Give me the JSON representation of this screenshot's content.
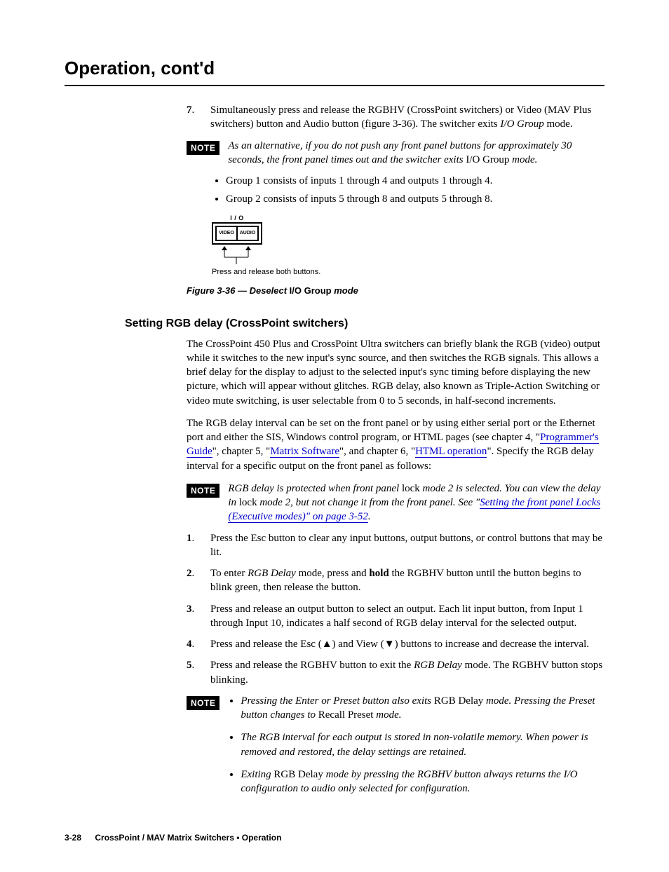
{
  "header": {
    "title": "Operation, cont'd"
  },
  "step7": {
    "num": "7",
    "text_a": "Simultaneously press and release the RGBHV (CrossPoint switchers) or Video (MAV Plus switchers) button and Audio button (figure 3-36).  The switcher exits ",
    "text_b": "I/O Group",
    "text_c": " mode."
  },
  "note1": {
    "label": "NOTE",
    "a": "As an alternative, if you do not push any front panel buttons for approximately 30 seconds, the front panel times out and the switcher exits ",
    "b": "I/O Group",
    "c": " mode."
  },
  "groups": {
    "g1": "Group 1 consists of inputs 1 through 4 and outputs 1 through 4.",
    "g2": "Group 2 consists of inputs 5 through 8 and outputs 5 through 8."
  },
  "io_diagram": {
    "header": "I / O",
    "btn_video": "VIDEO",
    "btn_audio": "AUDIO",
    "subcaption": "Press and release both buttons."
  },
  "fig_caption": {
    "a": "Figure 3-36 — Deselect ",
    "b": "I/O Group",
    "c": " mode"
  },
  "section": {
    "heading": "Setting RGB delay (CrossPoint switchers)"
  },
  "para1": "The CrossPoint 450 Plus and CrossPoint Ultra switchers can briefly blank the RGB (video) output while it switches to the new input's sync source, and then switches the RGB signals.  This allows a brief delay for the display to adjust to the selected input's sync timing before displaying the new picture, which will appear without glitches.  RGB delay, also known as Triple-Action Switching or video mute switching, is user selectable from 0 to 5 seconds, in half-second increments.",
  "para2": {
    "a": "The RGB delay interval can be set on the front panel or by using either serial port or the Ethernet port and either the SIS, Windows control program, or HTML pages (see chapter 4, \"",
    "link1": "Programmer's Guide",
    "b": "\", chapter 5, \"",
    "link2": "Matrix Software",
    "c": "\", and chapter 6, \"",
    "link3": "HTML operation",
    "d": "\".  Specify the RGB delay interval for a specific output on the front panel as follows:"
  },
  "note2": {
    "label": "NOTE",
    "a": "RGB delay is protected when front panel ",
    "b": "lock",
    "c": " mode 2 is selected.  You can view the delay in ",
    "d": "lock",
    "e": " mode 2, but not change it from the front panel.  See \"",
    "link": "Setting the front panel Locks (Executive modes)\" on page 3-52",
    "f": "."
  },
  "steps": {
    "s1": {
      "num": "1",
      "text": "Press the Esc button to clear any input buttons, output buttons, or control buttons that may be lit."
    },
    "s2": {
      "num": "2",
      "a": "To enter ",
      "b": "RGB Delay",
      "c": " mode, press and ",
      "d": "hold",
      "e": " the RGBHV button until the button begins to blink green, then release the button."
    },
    "s3": {
      "num": "3",
      "text": "Press and release an output button to select an output.  Each lit input button, from Input 1 through Input 10, indicates a half second of RGB delay interval for the selected output."
    },
    "s4": {
      "num": "4",
      "a": "Press and release the Esc (",
      "up": "▲",
      "b": ") and View (",
      "down": "▼",
      "c": ") buttons to increase and decrease the interval."
    },
    "s5": {
      "num": "5",
      "a": "Press and release the RGBHV button to exit the ",
      "b": "RGB Delay",
      "c": " mode.  The RGBHV button stops blinking."
    }
  },
  "note3": {
    "label": "NOTE",
    "b1a": "Pressing the Enter or Preset button also exits ",
    "b1b": "RGB Delay",
    "b1c": " mode.  Pressing the Preset button changes to ",
    "b1d": "Recall Preset",
    "b1e": " mode.",
    "b2": "The RGB interval for each output is stored in non-volatile memory.  When power is removed and restored, the delay settings are retained.",
    "b3a": "Exiting ",
    "b3b": "RGB Delay",
    "b3c": " mode by pressing the RGBHV button always returns the I/O configuration to audio only selected for configuration."
  },
  "footer": {
    "page": "3-28",
    "text": "CrossPoint / MAV Matrix Switchers • Operation"
  }
}
